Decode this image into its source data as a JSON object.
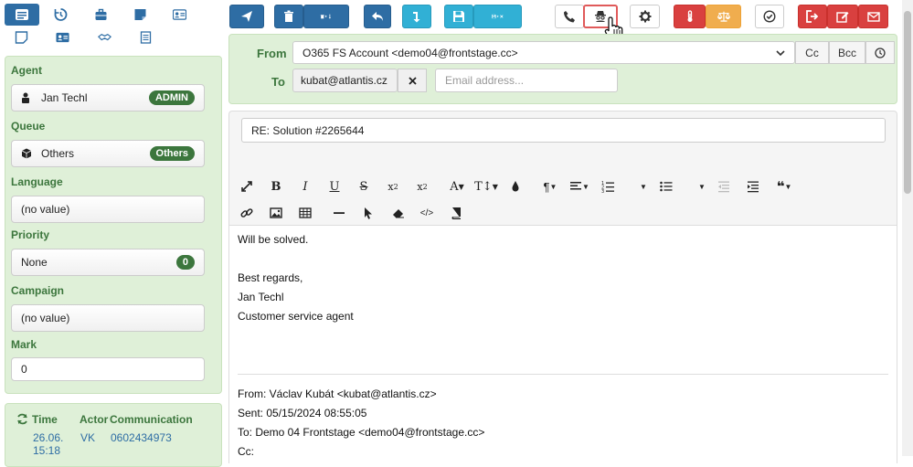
{
  "left_panel": {
    "agent_label": "Agent",
    "agent_value": "Jan Techl",
    "agent_badge": "ADMIN",
    "queue_label": "Queue",
    "queue_value": "Others",
    "queue_badge": "Others",
    "language_label": "Language",
    "language_value": "(no value)",
    "priority_label": "Priority",
    "priority_value": "None",
    "priority_badge": "0",
    "campaign_label": "Campaign",
    "campaign_value": "(no value)",
    "mark_label": "Mark",
    "mark_value": "0"
  },
  "history": {
    "col_time": "Time",
    "col_actor": "Actor",
    "col_communication": "Communication",
    "rows": [
      {
        "date": "26.06.",
        "time": "15:18",
        "actor": "VK",
        "communication": "0602434973"
      }
    ]
  },
  "header": {
    "from_label": "From",
    "from_value": "O365 FS Account <demo04@frontstage.cc>",
    "cc_label": "Cc",
    "bcc_label": "Bcc",
    "to_label": "To",
    "to_recipient": "kubat@atlantis.cz",
    "to_placeholder": "Email address..."
  },
  "subject": {
    "value": "RE: Solution #2265644"
  },
  "editor": {
    "lines": [
      "Will be solved.",
      "Best regards,",
      "Jan Techl",
      "Customer service agent",
      "From: Václav Kubát <kubat@atlantis.cz>",
      "Sent: 05/15/2024 08:55:05",
      "To: Demo 04 Frontstage <demo04@frontstage.cc>",
      "Cc:"
    ]
  },
  "colors": {
    "primary": "#2e6da4",
    "info": "#31b0d5",
    "danger": "#d9403f",
    "warning": "#f0ad4e",
    "success_bg": "#dff0d8",
    "success_text": "#3c763d"
  }
}
